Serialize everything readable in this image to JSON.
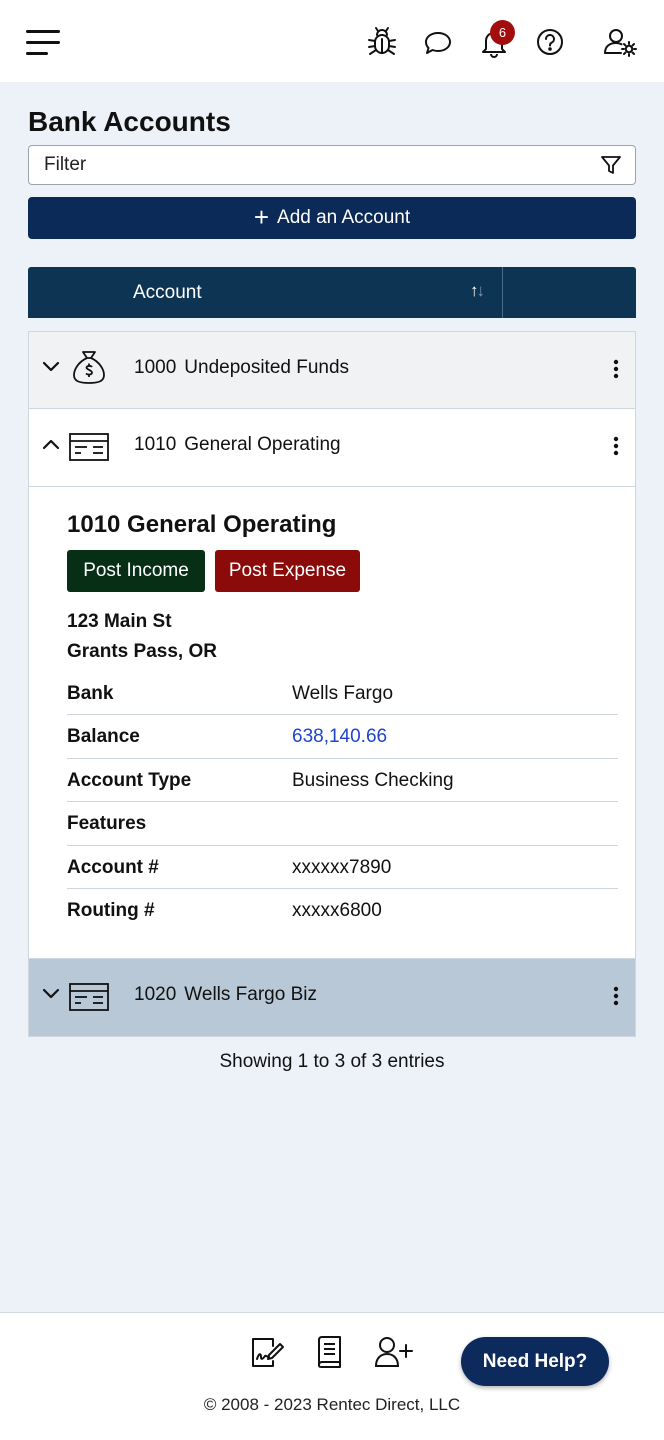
{
  "header": {
    "notification_count": "6"
  },
  "page": {
    "title": "Bank Accounts",
    "filter_placeholder": "Filter",
    "add_button_label": "Add an Account"
  },
  "table": {
    "column_label": "Account",
    "rows": [
      {
        "number": "1000",
        "name": "Undeposited Funds",
        "icon": "money-bag-icon",
        "state": "collapsed"
      },
      {
        "number": "1010",
        "name": "General Operating",
        "icon": "check-card-icon",
        "state": "expanded"
      },
      {
        "number": "1020",
        "name": "Wells Fargo Biz",
        "icon": "check-card-icon",
        "state": "collapsed"
      }
    ],
    "detail": {
      "title": "1010 General Operating",
      "post_income_label": "Post Income",
      "post_expense_label": "Post Expense",
      "address_line1": "123 Main St",
      "address_line2": "Grants Pass, OR",
      "fields": [
        {
          "key": "Bank",
          "value": "Wells Fargo"
        },
        {
          "key": "Balance",
          "value": "638,140.66"
        },
        {
          "key": "Account Type",
          "value": "Business Checking"
        },
        {
          "key": "Features",
          "value": ""
        },
        {
          "key": "Account #",
          "value": "xxxxxx7890"
        },
        {
          "key": "Routing #",
          "value": "xxxxx6800"
        }
      ]
    },
    "summary": "Showing 1 to 3 of 3 entries"
  },
  "footer": {
    "need_help_label": "Need Help?",
    "copyright": "© 2008 - 2023 Rentec Direct, LLC"
  },
  "colors": {
    "primary": "#0b2a57",
    "table_header": "#0d3452",
    "income": "#062f15",
    "expense": "#8b0a0a",
    "badge": "#a30d0d",
    "link": "#1f45c9",
    "highlight_row": "#b9c8d6"
  }
}
